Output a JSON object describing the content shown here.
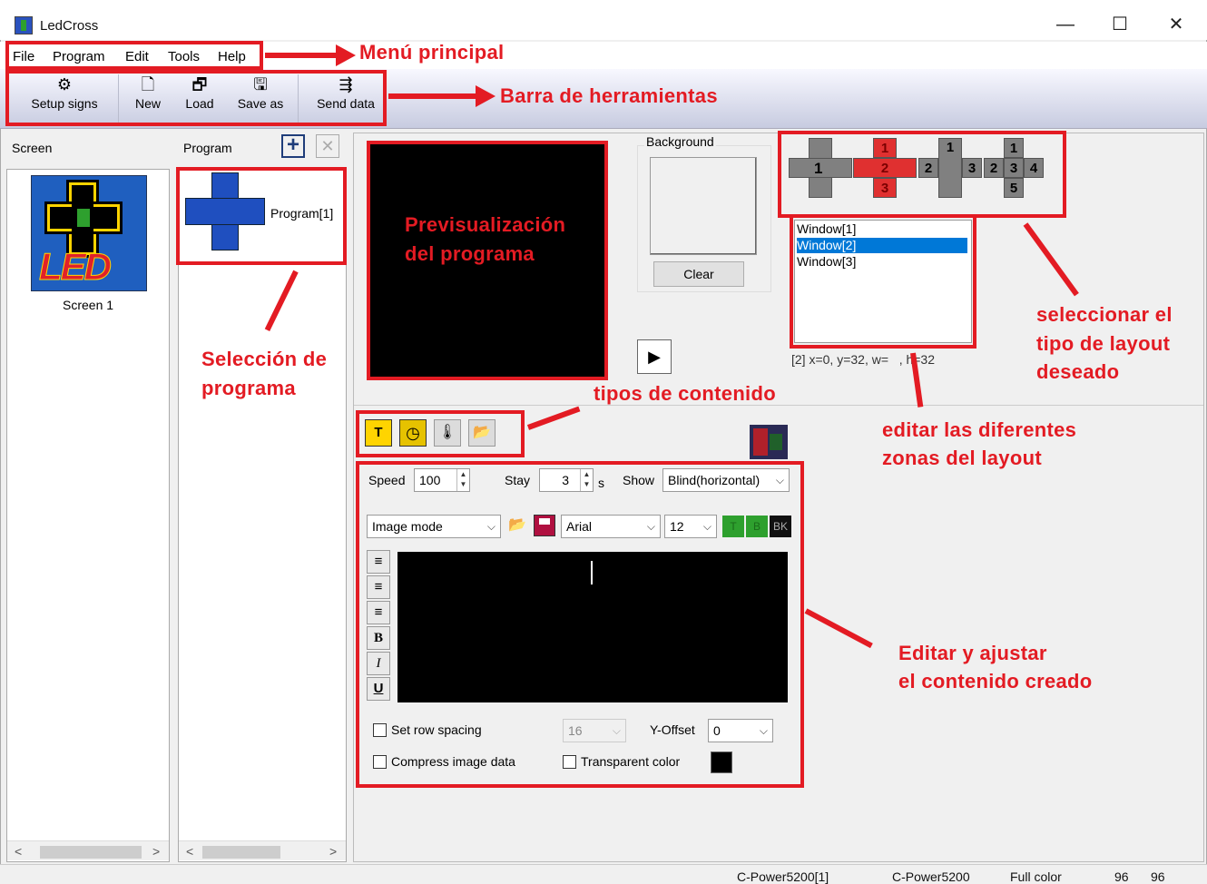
{
  "app": {
    "title": "LedCross",
    "minimize": "—",
    "maximize": "☐",
    "close": "✕"
  },
  "menu": [
    "File",
    "Program",
    "Edit",
    "Tools",
    "Help"
  ],
  "toolbar": [
    {
      "label": "Setup signs",
      "icon": "gear-icon",
      "glyph": "⚙"
    },
    {
      "label": "New",
      "icon": "new-file-icon",
      "glyph": "🗋"
    },
    {
      "label": "Load",
      "icon": "load-icon",
      "glyph": "🗗"
    },
    {
      "label": "Save as",
      "icon": "save-as-icon",
      "glyph": "🖫"
    },
    {
      "label": "Send data",
      "icon": "send-icon",
      "glyph": "⇶"
    }
  ],
  "screen_panel": {
    "header": "Screen",
    "item_label": "Screen 1",
    "logo_text": "LED"
  },
  "program_panel": {
    "header": "Program",
    "add": "+",
    "remove": "✕",
    "item_label": "Program[1]"
  },
  "background": {
    "label": "Background",
    "clear": "Clear"
  },
  "play": "▶",
  "layouts": {
    "opt1": [
      "1"
    ],
    "opt2": [
      "1",
      "2",
      "3"
    ],
    "opt3": [
      "1",
      "2",
      "3"
    ],
    "opt4": [
      "1",
      "2",
      "3",
      "4",
      "5"
    ]
  },
  "windows": {
    "items": [
      "Window[1]",
      "Window[2]",
      "Window[3]"
    ],
    "selected": 1,
    "info": "[2] x=0, y=32, w=",
    "info2": ", h=32"
  },
  "content_types": [
    {
      "icon": "text-icon",
      "glyph": "T"
    },
    {
      "icon": "clock-icon",
      "glyph": "◷"
    },
    {
      "icon": "thermometer-icon",
      "glyph": "🌡"
    },
    {
      "icon": "folder-icon",
      "glyph": "📂"
    }
  ],
  "editor": {
    "speed_label": "Speed",
    "speed": "100",
    "stay_label": "Stay",
    "stay": "3",
    "stay_unit": "s",
    "show_label": "Show",
    "show": "Blind(horizontal)",
    "mode": "Image mode",
    "font": "Arial",
    "size": "12",
    "color_t": "T",
    "color_b": "B",
    "color_bk": "BK",
    "bold": "B",
    "italic": "I",
    "underline": "U",
    "row_spacing_label": "Set row spacing",
    "row_spacing": "16",
    "yoffset_label": "Y-Offset",
    "yoffset": "0",
    "compress_label": "Compress image data",
    "transparent_label": "Transparent color"
  },
  "annotations": {
    "menu": "Menú principal",
    "toolbar": "Barra de herramientas",
    "program_sel_1": "Selección de",
    "program_sel_2": "programa",
    "preview_1": "Previsualización",
    "preview_2": "del programa",
    "layout_1": "seleccionar el",
    "layout_2": "tipo de layout",
    "layout_3": "deseado",
    "types": "tipos de contenido",
    "zones_1": "editar las diferentes",
    "zones_2": "zonas del layout",
    "edit_1": "Editar y ajustar",
    "edit_2": "el contenido creado"
  },
  "status": [
    "C-Power5200[1]",
    "C-Power5200",
    "Full color",
    "96",
    "96"
  ],
  "colors": {
    "accent_red": "#e31b23",
    "selection": "#0078d7"
  }
}
